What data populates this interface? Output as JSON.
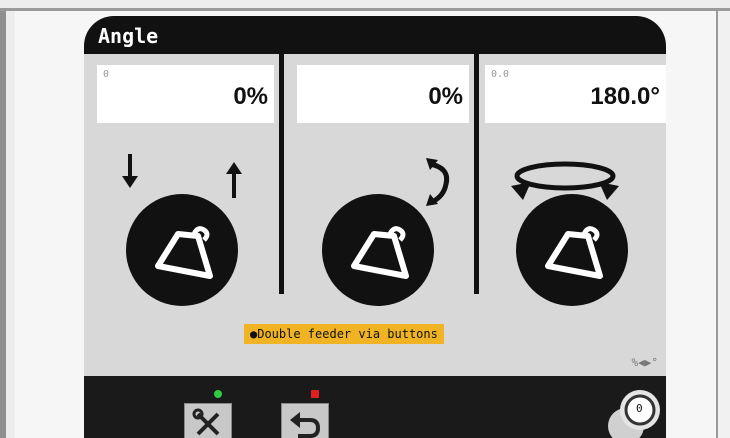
{
  "screen": {
    "title": "Angle"
  },
  "panels": [
    {
      "small_value": "0",
      "value": "0%"
    },
    {
      "small_value": "",
      "value": "0%"
    },
    {
      "small_value": "0.0",
      "value": "180.0°"
    }
  ],
  "note": {
    "text": "●Double feeder via buttons"
  },
  "unit_toggle": {
    "text": "%◀▶°"
  },
  "bottom": {
    "tools_button_icon": "tools-icon",
    "back_button_icon": "back-arrow-icon",
    "tools_led_color": "#2ecc40",
    "back_led_color": "#e02020",
    "knob_label": "0"
  },
  "colors": {
    "accent_yellow": "#f0b323",
    "screen_dark": "#111111",
    "content_gray": "#d8d8d8"
  }
}
